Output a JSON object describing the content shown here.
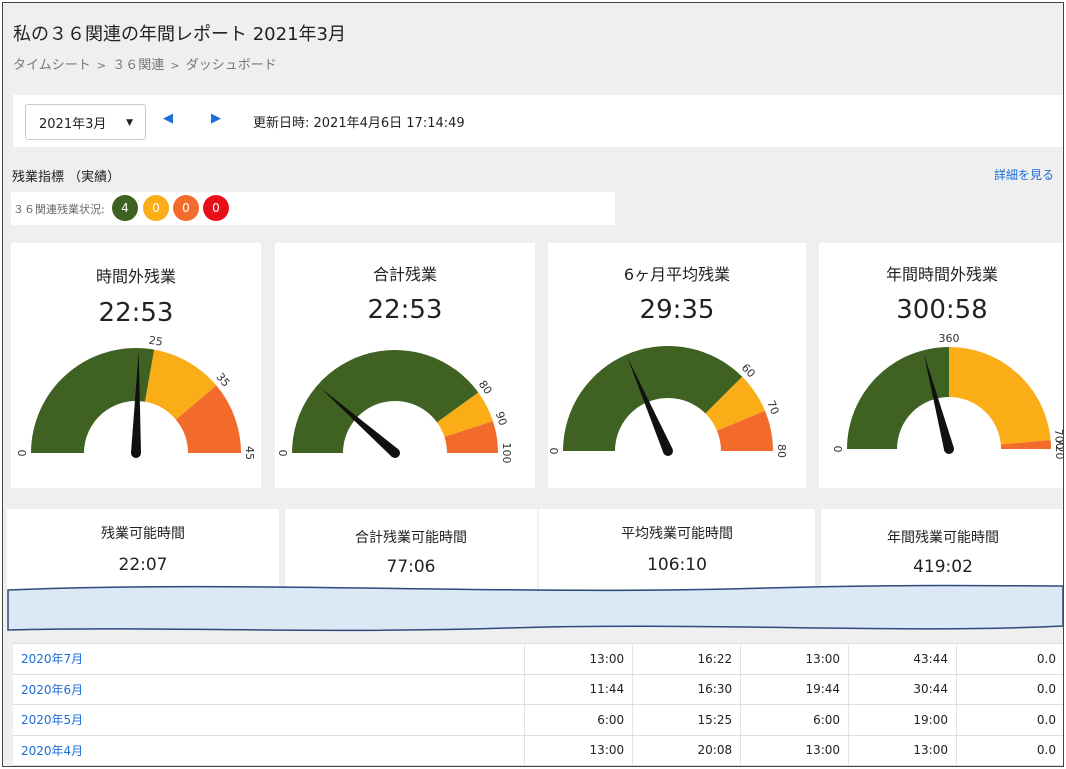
{
  "header": {
    "title": "私の３６関連の年間レポート 2021年3月",
    "breadcrumb": [
      "タイムシート",
      "３６関連",
      "ダッシュボード"
    ],
    "breadcrumb_sep": ">"
  },
  "toolbar": {
    "month_value": "2021年3月",
    "prev_icon": "◀",
    "next_icon": "▶",
    "updated_text": "更新日時: 2021年4月6日 17:14:49"
  },
  "kpi": {
    "heading": "残業指標 （実績）",
    "detail_link": "詳細を見る",
    "status_label": "３６関連残業状況:",
    "status_counts": [
      "4",
      "0",
      "0",
      "0"
    ],
    "status_colors": [
      "#3f6222",
      "#fbad18",
      "#f26b2a",
      "#e81018"
    ]
  },
  "gauges": [
    {
      "title": "時間外残業",
      "value": "22:53",
      "max": 45,
      "thresholds": [
        25,
        35
      ],
      "needle": 22.88,
      "ticks": [
        "0",
        "25",
        "35",
        "45"
      ]
    },
    {
      "title": "合計残業",
      "value": "22:53",
      "max": 100,
      "thresholds": [
        80,
        90
      ],
      "needle": 22.88,
      "ticks": [
        "0",
        "80",
        "90",
        "100"
      ]
    },
    {
      "title": "6ヶ月平均残業",
      "value": "29:35",
      "max": 80,
      "thresholds": [
        60,
        70
      ],
      "needle": 29.58,
      "ticks": [
        "0",
        "60",
        "70",
        "80"
      ]
    },
    {
      "title": "年間時間外残業",
      "value": "300:58",
      "max": 720,
      "thresholds": [
        360,
        700
      ],
      "needle": 300.97,
      "ticks": [
        "0",
        "360",
        "700",
        "720"
      ]
    }
  ],
  "gauge_colors": {
    "safe": "#3f6222",
    "warn": "#fbad18",
    "danger": "#f26b2a",
    "needle": "#111111"
  },
  "available": [
    {
      "title": "残業可能時間",
      "value": "22:07"
    },
    {
      "title": "合計残業可能時間",
      "value": "77:06"
    },
    {
      "title": "平均残業可能時間",
      "value": "106:10"
    },
    {
      "title": "年間残業可能時間",
      "value": "419:02"
    }
  ],
  "table": {
    "rows": [
      {
        "month": "2020年7月",
        "cells": [
          "13:00",
          "16:22",
          "13:00",
          "43:44",
          "0.0"
        ]
      },
      {
        "month": "2020年6月",
        "cells": [
          "11:44",
          "16:30",
          "19:44",
          "30:44",
          "0.0"
        ]
      },
      {
        "month": "2020年5月",
        "cells": [
          "6:00",
          "15:25",
          "6:00",
          "19:00",
          "0.0"
        ]
      },
      {
        "month": "2020年4月",
        "cells": [
          "13:00",
          "20:08",
          "13:00",
          "13:00",
          "0.0"
        ]
      }
    ]
  }
}
